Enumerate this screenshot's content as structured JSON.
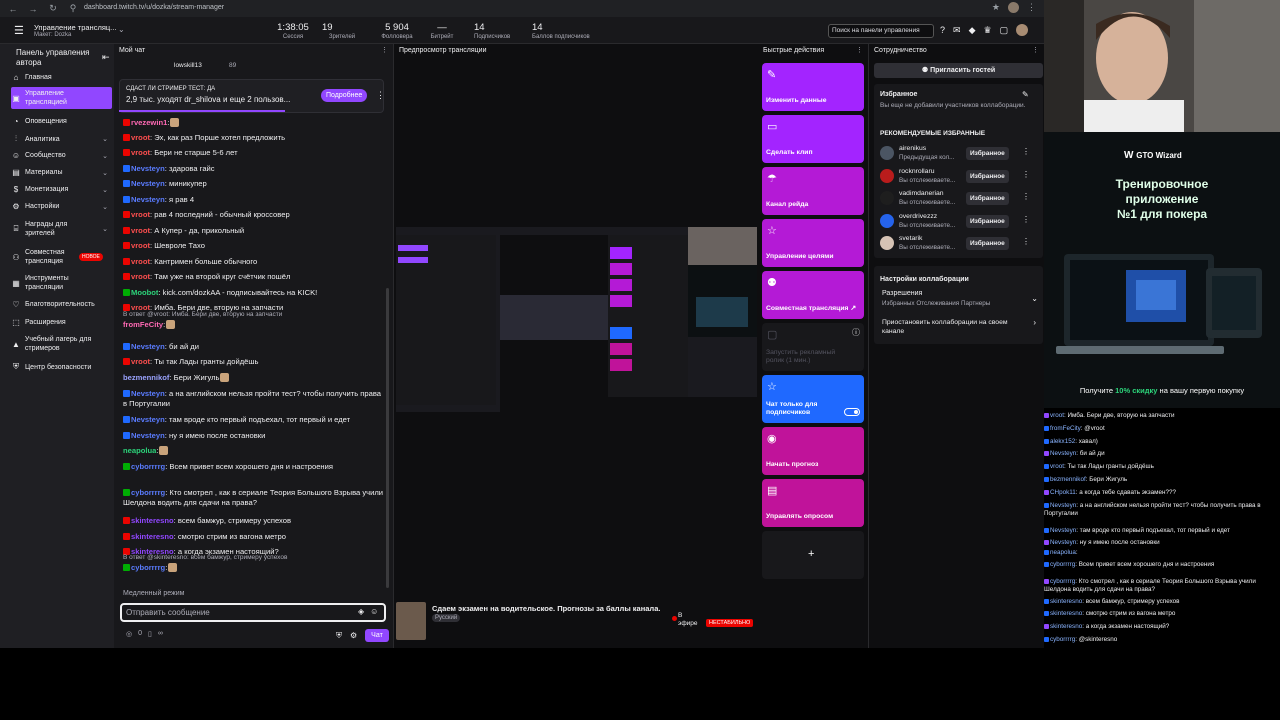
{
  "browser": {
    "url": "dashboard.twitch.tv/u/dozka/stream-manager"
  },
  "header": {
    "app_title": "Управление трансляц...",
    "app_subtitle": "Макет: Dozka",
    "stats": [
      {
        "value": "1:38:05",
        "label": "Сессия"
      },
      {
        "value": "19",
        "label": "Зрителей"
      },
      {
        "value": "5 904",
        "label": "Фолловера"
      },
      {
        "value": "—",
        "label": "Битрейт"
      },
      {
        "value": "14",
        "label": "Подписчиков"
      },
      {
        "value": "14",
        "label": "Баллов подписчиков"
      }
    ],
    "search_placeholder": "Поиск на панели управления"
  },
  "sidebar": {
    "title": "Панель управления автора",
    "items": [
      {
        "label": "Главная",
        "chevron": false
      },
      {
        "label": "Управление трансляцией",
        "chevron": false,
        "active": true
      },
      {
        "label": "Оповещения",
        "chevron": false
      },
      {
        "label": "Аналитика",
        "chevron": true
      },
      {
        "label": "Сообщество",
        "chevron": true
      },
      {
        "label": "Материалы",
        "chevron": true
      },
      {
        "label": "Монетизация",
        "chevron": true
      },
      {
        "label": "Настройки",
        "chevron": true
      },
      {
        "label": "Награды для зрителей",
        "chevron": true
      },
      {
        "label": "Совместная трансляция",
        "chevron": false,
        "badge": "НОВОЕ"
      },
      {
        "label": "Инструменты трансляции",
        "chevron": false
      },
      {
        "label": "Благотворительность",
        "chevron": false
      },
      {
        "label": "Расширения",
        "chevron": false
      },
      {
        "label": "Учебный лагерь для стримеров",
        "chevron": false
      },
      {
        "label": "Центр безопасности",
        "chevron": false
      }
    ]
  },
  "chat": {
    "header": "Мой чат",
    "top_user": "lowskill13",
    "top_viewers": "89",
    "poll_tag": "СДАСТ ЛИ СТРИМЕР ТЕСТ: ДА",
    "poll_text": "2,9 тыс. уходят dr_shilova и еще 2 пользов...",
    "poll_button": "Подробнее",
    "messages": [
      {
        "user": "rvezewin1",
        "text": ":",
        "color": "#ff69b4"
      },
      {
        "user": "vroot",
        "text": "Эх, как раз Порше хотел предложить",
        "color": "#ff4f4f"
      },
      {
        "user": "vroot",
        "text": "Бери не старше 5-6 лет",
        "color": "#ff4f4f"
      },
      {
        "user": "Nevsteyn",
        "text": "здарова гайс",
        "color": "#5a7cff"
      },
      {
        "user": "Nevsteyn",
        "text": "миникупер",
        "color": "#5a7cff"
      },
      {
        "user": "Nevsteyn",
        "text": "я рав 4",
        "color": "#5a7cff"
      },
      {
        "user": "vroot",
        "text": "рав 4 последний - обычный кроссовер",
        "color": "#ff4f4f"
      },
      {
        "user": "vroot",
        "text": "А Купер - да, прикольный",
        "color": "#ff4f4f"
      },
      {
        "user": "vroot",
        "text": "Шевроле Тахо",
        "color": "#ff4f4f"
      },
      {
        "user": "vroot",
        "text": "Кантримен больше обычного",
        "color": "#ff4f4f"
      },
      {
        "user": "vroot",
        "text": "Там уже на второй круг счётчик пошёл",
        "color": "#ff4f4f"
      },
      {
        "user": "Moobot",
        "text": "kick.com/dozkAA - подписывайтесь на KICK!",
        "color": "#2cd37a"
      },
      {
        "user": "vroot",
        "text": "Имба. Бери две, вторую на запчасти",
        "color": "#ff4f4f"
      },
      {
        "user": "fromFeCity",
        "text": ":",
        "color": "#ff69b4",
        "reply": "В ответ @vroot: Имба. Бери две, вторую на запчасти"
      },
      {
        "user": "Nevsteyn",
        "text": "би ай ди",
        "color": "#5a7cff"
      },
      {
        "user": "vroot",
        "text": "Ты так Лады гранты дойдёшь",
        "color": "#ff4f4f"
      },
      {
        "user": "bezmennikof",
        "text": "Бери Жигуль",
        "color": "#9aa3ff"
      },
      {
        "user": "Nevsteyn",
        "text": "а на английском нельзя пройти тест? чтобы получить права в Португалии",
        "color": "#5a7cff"
      },
      {
        "user": "Nevsteyn",
        "text": "там вроде кто первый подъехал, тот первый и едет",
        "color": "#5a7cff"
      },
      {
        "user": "Nevsteyn",
        "text": "ну я имею после остановки",
        "color": "#5a7cff"
      },
      {
        "user": "neapolua",
        "text": ":",
        "color": "#2cd37a"
      },
      {
        "user": "cyborrrrg",
        "text": "Всем привет  всем хорошего дня и настроения",
        "color": "#5a7cff"
      },
      {
        "user": "cyborrrrg",
        "text": "Кто смотрел , как в сериале Теория Большого Взрыва учили Шелдона водить для сдачи на права?",
        "color": "#5a7cff"
      },
      {
        "user": "skinteresno",
        "text": "всем бамжур, стримеру успехов",
        "color": "#9147ff"
      },
      {
        "user": "skinteresno",
        "text": "смотрю стрим из вагона метро",
        "color": "#9147ff"
      },
      {
        "user": "skinteresno",
        "text": "а когда экзамен настоящий?",
        "color": "#9147ff"
      },
      {
        "user": "cyborrrrg",
        "text": ":",
        "color": "#5a7cff",
        "reply": "В ответ @skinteresno: всем бамжур, стримеру успехов"
      }
    ],
    "slow_mode": "Медленный режим",
    "input_placeholder": "Отправить сообщение",
    "points": "0",
    "send_label": "Чат"
  },
  "preview": {
    "header": "Предпросмотр трансляции",
    "stream_title": "Сдаем экзамен на водительское. Прогнозы за баллы канала.",
    "language": "Русский",
    "live_label": "В эфире",
    "unstable_label": "НЕСТАБИЛЬНО"
  },
  "quick_actions": {
    "header": "Быстрые действия",
    "items": [
      {
        "label": "Изменить данные",
        "icon": "pencil-icon",
        "color": "#a324ff"
      },
      {
        "label": "Сделать клип",
        "icon": "clip-icon",
        "color": "#a324ff"
      },
      {
        "label": "Канал рейда",
        "icon": "raid-icon",
        "color": "#b41ad6"
      },
      {
        "label": "Управление целями",
        "icon": "star-icon",
        "color": "#b41ad6"
      },
      {
        "label": "Совместная трансляция ↗",
        "icon": "add-person-icon",
        "color": "#b41ad6"
      },
      {
        "label": "Запустить рекламный ролик (1 мин.)",
        "icon": "ad-icon",
        "color": "#18181b",
        "disabled": true
      },
      {
        "label": "Чат только для подписчиков",
        "icon": "star-icon",
        "color": "#1f69ff",
        "toggle": true
      },
      {
        "label": "Начать прогноз",
        "icon": "prediction-icon",
        "color": "#c0139a"
      },
      {
        "label": "Управлять опросом",
        "icon": "poll-icon",
        "color": "#c0139a"
      },
      {
        "label": "+",
        "icon": "plus-icon",
        "color": "#18181b"
      }
    ]
  },
  "collab": {
    "header": "Сотрудничество",
    "invite_label": "Пригласить гостей",
    "favorites_title": "Избранное",
    "favorites_empty": "Вы еще не добавили участников коллаборации.",
    "recommended_title": "РЕКОМЕНДУЕМЫЕ ИЗБРАННЫЕ",
    "recommended": [
      {
        "name": "airenikus",
        "sub": "Предыдущая кол...",
        "btn": "Избранное",
        "color": "#4b5563"
      },
      {
        "name": "rocknrollaru",
        "sub": "Вы отслеживаете...",
        "btn": "Избранное",
        "color": "#b91c1c"
      },
      {
        "name": "vadimdanerian",
        "sub": "Вы отслеживаете...",
        "btn": "Избранное",
        "color": "#1e1e1e"
      },
      {
        "name": "overdrivezzz",
        "sub": "Вы отслеживаете...",
        "btn": "Избранное",
        "color": "#2563eb"
      },
      {
        "name": "svetarik",
        "sub": "Вы отслеживаете...",
        "btn": "Избранное",
        "color": "#d6c3b5"
      }
    ],
    "settings_title": "Настройки коллаборации",
    "permissions_title": "Разрешения",
    "permissions_value": "Избранных Отслеживания Партнеры",
    "pause_label": "Приостановить коллаборации на своем канале"
  },
  "overlay": {
    "ad_brand": "GTO Wizard",
    "ad_heading_1": "Тренировочное",
    "ad_heading_2": "приложение",
    "ad_heading_3": "№1 для покера",
    "ad_footer_pre": "Получите ",
    "ad_footer_bold": "10% скидку",
    "ad_footer_post": " на вашу первую покупку",
    "chat": [
      {
        "user": "vroot",
        "text": "Имба. Бери две, вторую на запчасти"
      },
      {
        "user": "fromFeCity",
        "text": "@vroot"
      },
      {
        "user": "alekx152",
        "text": "хавал)"
      },
      {
        "user": "Nevsteyn",
        "text": "би ай ди"
      },
      {
        "user": "vroot",
        "text": "Ты так Лады гранты дойдёшь"
      },
      {
        "user": "bezmennikof",
        "text": "Бери Жигуль"
      },
      {
        "user": "CHpok11",
        "text": "а когда тебе сдавать экзамен???"
      },
      {
        "user": "Nevsteyn",
        "text": "а на английском нельзя пройти тест? чтобы получить права в Португалии"
      },
      {
        "user": "Nevsteyn",
        "text": "там вроде кто первый подъехал, тот первый и едет"
      },
      {
        "user": "Nevsteyn",
        "text": "ну я имею после остановки"
      },
      {
        "user": "neapolua",
        "text": ""
      },
      {
        "user": "cyborrrrg",
        "text": "Всем привет  всем хорошего дня и настроения"
      },
      {
        "user": "cyborrrrg",
        "text": "Кто смотрел , как в сериале Теория Большого Взрыва учили Шелдона водить для сдачи на права?"
      },
      {
        "user": "skinteresno",
        "text": "всем бамжур, стримеру успехов"
      },
      {
        "user": "skinteresno",
        "text": "смотрю стрим из вагона метро"
      },
      {
        "user": "skinteresno",
        "text": "а когда экзамен настоящий?"
      },
      {
        "user": "cyborrrrg",
        "text": "@skinteresno"
      }
    ]
  }
}
